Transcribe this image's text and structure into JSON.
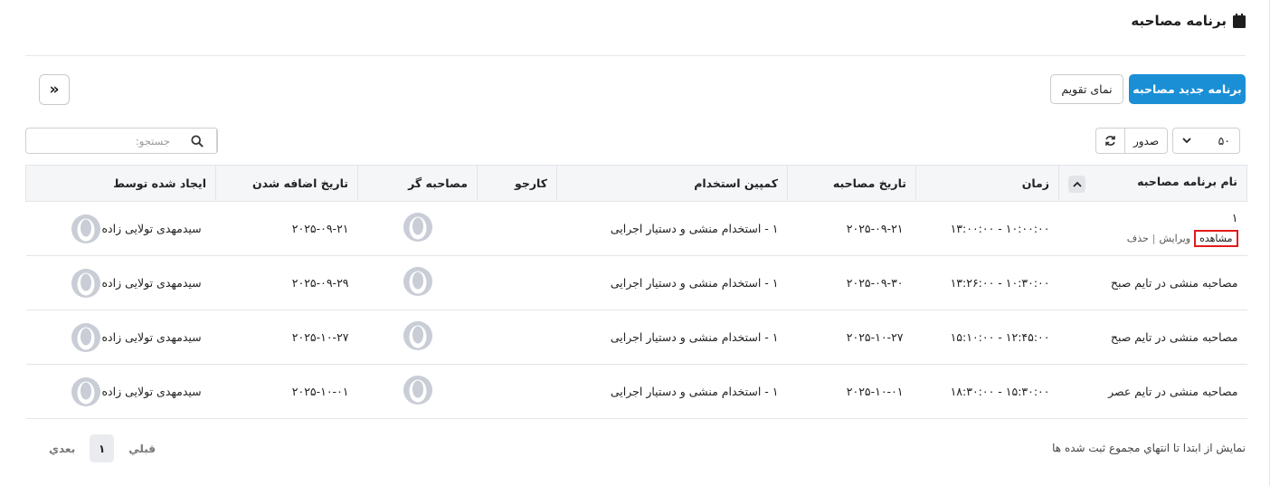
{
  "page": {
    "title": "برنامه مصاحبه",
    "title_icon": "calendar-icon"
  },
  "toolbar": {
    "new_label": "برنامه جدید مصاحبه",
    "calendar_label": "نمای تقویم",
    "collapse_symbol": "»",
    "page_size": "۵۰",
    "export_label": "صدور",
    "search_placeholder": "جستجو:"
  },
  "table": {
    "headers": {
      "name": "نام برنامه مصاحبه",
      "time": "زمان",
      "date": "تاریخ مصاحبه",
      "campaign": "کمپین استخدام",
      "jobseeker": "کارجو",
      "interviewer": "مصاحبه گر",
      "added": "تاریخ اضافه شدن",
      "creator": "ایجاد شده توسط"
    },
    "row_actions": {
      "view": "مشاهده",
      "edit": "ویرایش",
      "sep": "|",
      "delete": "حذف"
    },
    "rows": [
      {
        "name": "۱",
        "time": "۱۰:۰۰:۰۰ - ۱۳:۰۰:۰۰",
        "date": "۲۰۲۵-۰۹-۲۱",
        "campaign": "۱ - استخدام منشی و دستیار اجرایی",
        "jobseeker": "",
        "added": "۲۰۲۵-۰۹-۲۱",
        "creator": "سیدمهدی تولایی زاده"
      },
      {
        "name": "مصاحبه منشی در تایم صبح",
        "time": "۱۰:۳۰:۰۰ - ۱۳:۲۶:۰۰",
        "date": "۲۰۲۵-۰۹-۳۰",
        "campaign": "۱ - استخدام منشی و دستیار اجرایی",
        "jobseeker": "",
        "added": "۲۰۲۵-۰۹-۲۹",
        "creator": "سیدمهدی تولایی زاده"
      },
      {
        "name": "مصاحبه منشی در تایم صبح",
        "time": "۱۲:۴۵:۰۰ - ۱۵:۱۰:۰۰",
        "date": "۲۰۲۵-۱۰-۲۷",
        "campaign": "۱ - استخدام منشی و دستیار اجرایی",
        "jobseeker": "",
        "added": "۲۰۲۵-۱۰-۲۷",
        "creator": "سیدمهدی تولایی زاده"
      },
      {
        "name": "مصاحبه منشی در تایم عصر",
        "time": "۱۵:۳۰:۰۰ - ۱۸:۳۰:۰۰",
        "date": "۲۰۲۵-۱۰-۰۱",
        "campaign": "۱ - استخدام منشی و دستیار اجرایی",
        "jobseeker": "",
        "added": "۲۰۲۵-۱۰-۰۱",
        "creator": "سیدمهدی تولایی زاده"
      }
    ]
  },
  "footer": {
    "info": "نمایش از ابتدا تا انتهاي مجموع ثبت شده ها",
    "prev": "قبلي",
    "current": "۱",
    "next": "بعدي"
  },
  "colors": {
    "primary": "#1a8fd6",
    "highlight": "#e21b1b",
    "header_bg": "#f5f6f8"
  }
}
